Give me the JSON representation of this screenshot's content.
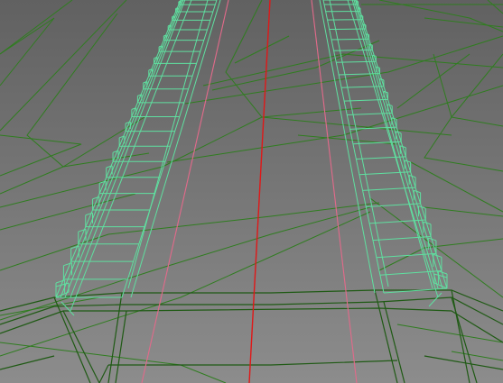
{
  "viewport": {
    "background_top": "#616161",
    "background_bottom": "#8c8c8c"
  },
  "colors": {
    "terrain_wire": "#2f7d1f",
    "terrain_wire_dark": "#1f5a14",
    "railing_wire": "#5fe0a0",
    "lane_line": "#e26a8a",
    "center_line": "#e01818"
  },
  "layers": [
    {
      "name": "terrain-mesh",
      "color_key": "terrain_wire"
    },
    {
      "name": "bridge-deck-edges",
      "color_key": "terrain_wire_dark"
    },
    {
      "name": "railing-left",
      "color_key": "railing_wire"
    },
    {
      "name": "railing-right",
      "color_key": "railing_wire"
    },
    {
      "name": "lane-lines",
      "color_key": "lane_line"
    },
    {
      "name": "center-line",
      "color_key": "center_line"
    }
  ]
}
